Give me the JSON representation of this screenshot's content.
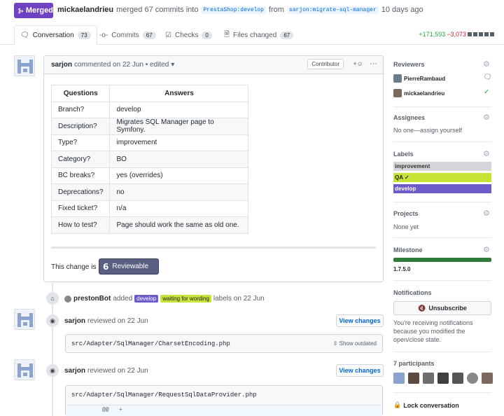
{
  "header": {
    "status_badge": "Merged",
    "author": "mickaelandrieu",
    "merged_text": "merged 67 commits into",
    "base_branch": "PrestaShop:develop",
    "from_text": "from",
    "head_branch": "sarjon:migrate-sql-manager",
    "time_ago": "10 days ago"
  },
  "tabs": [
    {
      "label": "Conversation",
      "count": "73",
      "icon": "comment-discussion-icon"
    },
    {
      "label": "Commits",
      "count": "67",
      "icon": "git-commit-icon"
    },
    {
      "label": "Checks",
      "count": "0",
      "icon": "checklist-icon"
    },
    {
      "label": "Files changed",
      "count": "67",
      "icon": "file-diff-icon"
    }
  ],
  "diffstat": {
    "additions": "+171,593",
    "deletions": "−3,073"
  },
  "comment": {
    "author": "sarjon",
    "meta": "commented on 22 Jun • edited",
    "badge": "Contributor",
    "table_headers": [
      "Questions",
      "Answers"
    ],
    "rows": [
      {
        "q": "Branch?",
        "a": "develop"
      },
      {
        "q": "Description?",
        "a": "Migrates SQL Manager page to Symfony."
      },
      {
        "q": "Type?",
        "a": "improvement"
      },
      {
        "q": "Category?",
        "a": "BO"
      },
      {
        "q": "BC breaks?",
        "a": "yes (overrides)"
      },
      {
        "q": "Deprecations?",
        "a": "no"
      },
      {
        "q": "Fixed ticket?",
        "a": "n/a"
      },
      {
        "q": "How to test?",
        "a": "Page should work the same as old one."
      }
    ],
    "change_text": "This change is",
    "reviewable_label": "Reviewable"
  },
  "timeline": {
    "label_event": {
      "actor": "prestonBot",
      "verb": "added",
      "label1": "develop",
      "label2": "waiting for wording",
      "suffix": "labels on 22 Jun"
    },
    "reviews": [
      {
        "author": "sarjon",
        "meta": "reviewed on 22 Jun",
        "button": "View changes",
        "file": "src/Adapter/SqlManager/CharsetEncoding.php",
        "outdated": "Show outdated"
      },
      {
        "author": "sarjon",
        "meta": "reviewed on 22 Jun",
        "button": "View changes",
        "file": "src/Adapter/SqlManager/RequestSqlDataProvider.php",
        "hunk": "@@",
        "hunk_plus": "+"
      }
    ]
  },
  "sidebar": {
    "reviewers_title": "Reviewers",
    "reviewers": [
      {
        "name": "PierreRambaud",
        "status_icon": "comment-icon"
      },
      {
        "name": "mickaelandrieu",
        "status_icon": "check-icon"
      }
    ],
    "assignees_title": "Assignees",
    "assignees_text": "No one—assign yourself",
    "labels_title": "Labels",
    "labels": [
      {
        "name": "improvement",
        "color": "#d4d5d8"
      },
      {
        "name": "QA ✓",
        "color": "#c6e234"
      },
      {
        "name": "develop",
        "color": "#6e5ac9"
      }
    ],
    "projects_title": "Projects",
    "projects_text": "None yet",
    "milestone_title": "Milestone",
    "milestone_progress": 1.0,
    "milestone_name": "1.7.5.0",
    "notifications_title": "Notifications",
    "unsubscribe_label": "Unsubscribe",
    "notif_text": "You're receiving notifications because you modified the open/close state.",
    "participants_title": "7 participants",
    "lock_label": "Lock conversation"
  }
}
